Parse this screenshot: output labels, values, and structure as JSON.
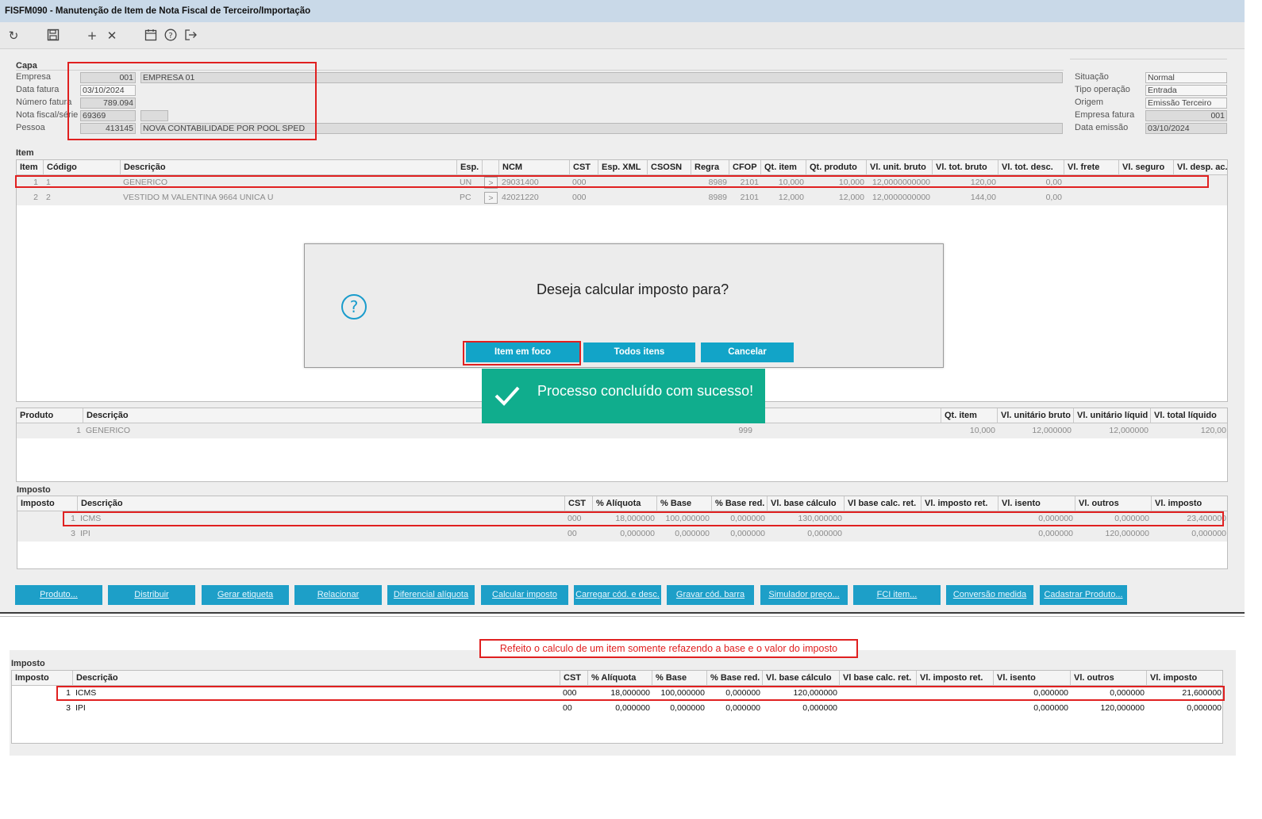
{
  "window": {
    "title": "FISFM090 - Manutenção de Item de Nota Fiscal de Terceiro/Importação"
  },
  "toolbar": {
    "icons": [
      "refresh-icon",
      "save-icon",
      "add-icon",
      "delete-icon",
      "calendar-icon",
      "help-icon",
      "exit-icon"
    ]
  },
  "capa": {
    "label": "Capa",
    "empresa_label": "Empresa",
    "empresa_code": "001",
    "empresa_name": "EMPRESA 01",
    "data_fatura_label": "Data fatura",
    "data_fatura": "03/10/2024",
    "numero_fatura_label": "Número fatura",
    "numero_fatura": "789.094",
    "nota_label": "Nota fiscal/série",
    "nota": "69369",
    "serie": "",
    "pessoa_label": "Pessoa",
    "pessoa_code": "413145",
    "pessoa_name": "NOVA CONTABILIDADE POR POOL SPED"
  },
  "side": {
    "situacao_label": "Situação",
    "situacao": "Normal",
    "tipo_label": "Tipo operação",
    "tipo": "Entrada",
    "origem_label": "Origem",
    "origem": "Emissão Terceiro",
    "empresa_fatura_label": "Empresa fatura",
    "empresa_fatura": "001",
    "data_emissao_label": "Data emissão",
    "data_emissao": "03/10/2024"
  },
  "item_grid": {
    "label": "Item",
    "headers": [
      "Item",
      "Código",
      "Descrição",
      "Esp.",
      "",
      "NCM",
      "CST",
      "Esp. XML",
      "CSOSN",
      "Regra",
      "CFOP",
      "Qt. item",
      "Qt. produto",
      "Vl. unit. bruto",
      "Vl. tot. bruto",
      "Vl. tot. desc.",
      "Vl. frete",
      "Vl. seguro",
      "Vl. desp. ac."
    ],
    "rows": [
      {
        "item": "1",
        "codigo": "1",
        "descricao": "GENERICO",
        "esp": "UN",
        "btn": ">",
        "ncm": "29031400",
        "cst": "000",
        "regra": "8989",
        "cfop": "2101",
        "qt_item": "10,000",
        "qt_produto": "10,000",
        "vl_unit": "12,0000000000",
        "vl_tot": "120,00",
        "vl_desc": "0,00"
      },
      {
        "item": "2",
        "codigo": "2",
        "descricao": "VESTIDO M VALENTINA 9664 UNICA U",
        "esp": "PC",
        "btn": ">",
        "ncm": "42021220",
        "cst": "000",
        "regra": "8989",
        "cfop": "2101",
        "qt_item": "12,000",
        "qt_produto": "12,000",
        "vl_unit": "12,0000000000",
        "vl_tot": "144,00",
        "vl_desc": "0,00"
      }
    ]
  },
  "dialog": {
    "question": "Deseja calcular imposto para?",
    "btn_item": "Item em foco",
    "btn_todos": "Todos itens",
    "btn_cancel": "Cancelar"
  },
  "toast": {
    "message": "Processo concluído com sucesso!"
  },
  "produto_grid": {
    "headers": [
      "Produto",
      "Descrição",
      "Qt. item",
      "Vl. unitário bruto",
      "Vl. unitário líquid",
      "Vl. total líquido"
    ],
    "row": {
      "produto": "1",
      "descricao": "GENERICO",
      "extra": "999",
      "qt_item": "10,000",
      "vl_unit_bruto": "12,000000",
      "vl_unit_liq": "12,000000",
      "vl_total": "120,00"
    }
  },
  "imposto_grid": {
    "label": "Imposto",
    "headers": [
      "Imposto",
      "Descrição",
      "CST",
      "% Alíquota",
      "% Base",
      "% Base red.",
      "Vl. base cálculo",
      "Vl base calc. ret.",
      "Vl. imposto ret.",
      "Vl. isento",
      "Vl. outros",
      "Vl. imposto"
    ],
    "rows": [
      {
        "imposto": "1",
        "descricao": "ICMS",
        "cst": "000",
        "aliquota": "18,000000",
        "base": "100,000000",
        "base_red": "0,000000",
        "base_calc": "130,000000",
        "isento": "0,000000",
        "outros": "0,000000",
        "imposto_val": "23,400000"
      },
      {
        "imposto": "3",
        "descricao": "IPI",
        "cst": "00",
        "aliquota": "0,000000",
        "base": "0,000000",
        "base_red": "0,000000",
        "base_calc": "0,000000",
        "isento": "0,000000",
        "outros": "120,000000",
        "imposto_val": "0,000000"
      }
    ]
  },
  "buttons": [
    "Produto...",
    "Distribuir",
    "Gerar etiqueta",
    "Relacionar",
    "Diferencial alíquota",
    "Calcular imposto",
    "Carregar cód. e desc.",
    "Gravar cód. barra",
    "Simulador preço...",
    "FCI item...",
    "Conversão medida",
    "Cadastrar Produto..."
  ],
  "annotation": {
    "note": "Refeito o calculo de um item somente refazendo a base e o valor do imposto"
  },
  "imposto_grid2": {
    "label": "Imposto",
    "headers": [
      "Imposto",
      "Descrição",
      "CST",
      "% Alíquota",
      "% Base",
      "% Base red.",
      "Vl. base cálculo",
      "Vl base calc. ret.",
      "Vl. imposto ret.",
      "Vl. isento",
      "Vl. outros",
      "Vl. imposto"
    ],
    "rows": [
      {
        "imposto": "1",
        "descricao": "ICMS",
        "cst": "000",
        "aliquota": "18,000000",
        "base": "100,000000",
        "base_red": "0,000000",
        "base_calc": "120,000000",
        "isento": "0,000000",
        "outros": "0,000000",
        "imposto_val": "21,600000"
      },
      {
        "imposto": "3",
        "descricao": "IPI",
        "cst": "00",
        "aliquota": "0,000000",
        "base": "0,000000",
        "base_red": "0,000000",
        "base_calc": "0,000000",
        "isento": "0,000000",
        "outros": "120,000000",
        "imposto_val": "0,000000"
      }
    ]
  },
  "colors": {
    "titlebar": "#c9d9e8",
    "button": "#1d9fc8",
    "toast": "#10ad8d",
    "highlight": "#e02020"
  }
}
